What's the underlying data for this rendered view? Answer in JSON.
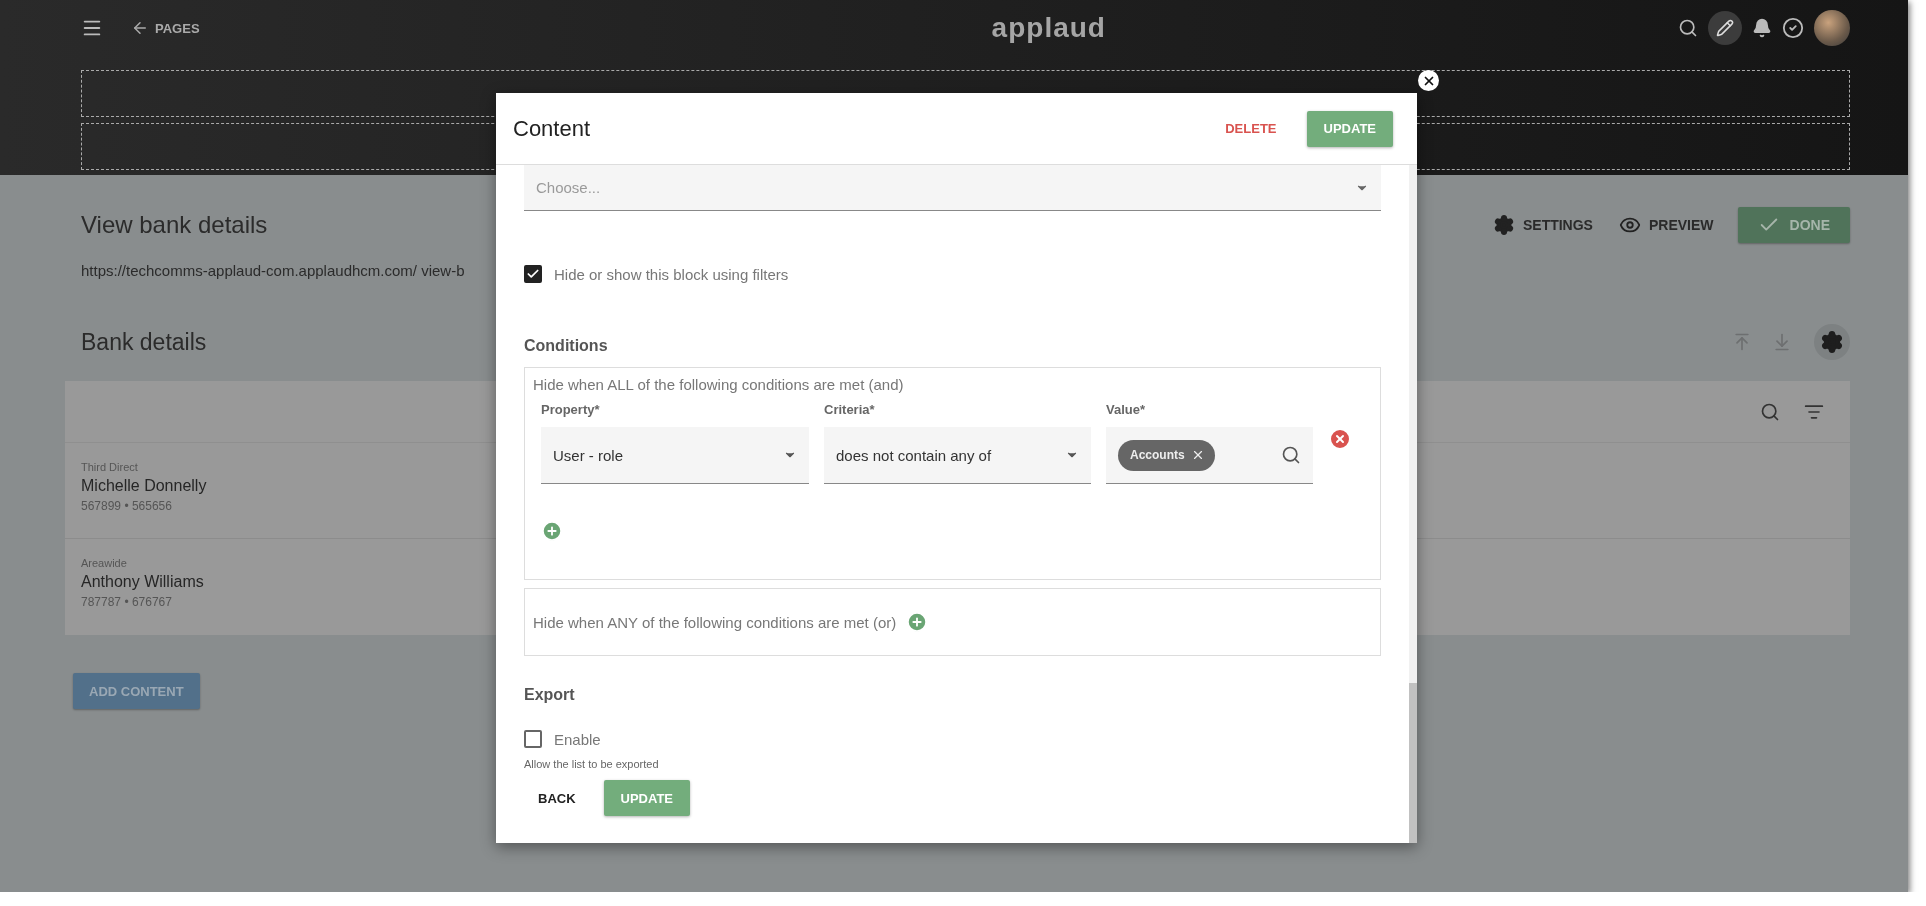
{
  "top_bar": {
    "back_label": "PAGES",
    "logo": "applaud"
  },
  "page": {
    "title": "View bank details",
    "url": "https://techcomms-applaud-com.applaudhcm.com/ view-b",
    "actions": [
      {
        "kind": "settings",
        "label": "SETTINGS"
      },
      {
        "kind": "preview",
        "label": "PREVIEW"
      },
      {
        "kind": "done",
        "label": "DONE"
      }
    ],
    "section_title": "Bank details",
    "rows": [
      {
        "bank": "Third Direct",
        "name": "Michelle Donnelly",
        "numbers": "567899 • 565656"
      },
      {
        "bank": "Areawide",
        "name": "Anthony Williams",
        "numbers": "787787 • 676767"
      }
    ],
    "add_button": "ADD CONTENT"
  },
  "dialog": {
    "title": "Content",
    "delete_label": "DELETE",
    "update_label": "UPDATE",
    "select": {
      "placeholder": "Choose..."
    },
    "filter_checkbox": {
      "label": "Hide or show this block using filters",
      "checked": true
    },
    "conditions_heading": "Conditions",
    "all_group": {
      "title": "Hide when ALL of the following conditions are met (and)",
      "columns": [
        "Property*",
        "Criteria*",
        "Value*"
      ],
      "rows": [
        {
          "property": "User - role",
          "criteria": "does not contain any of",
          "values": [
            "Accounts"
          ]
        }
      ]
    },
    "any_group": {
      "title": "Hide when ANY of the following conditions are met (or)"
    },
    "export_heading": "Export",
    "export_checkbox": {
      "label": "Enable",
      "checked": false
    },
    "export_help": "Allow the list to be exported",
    "back_label": "BACK",
    "footer_update_label": "UPDATE"
  }
}
